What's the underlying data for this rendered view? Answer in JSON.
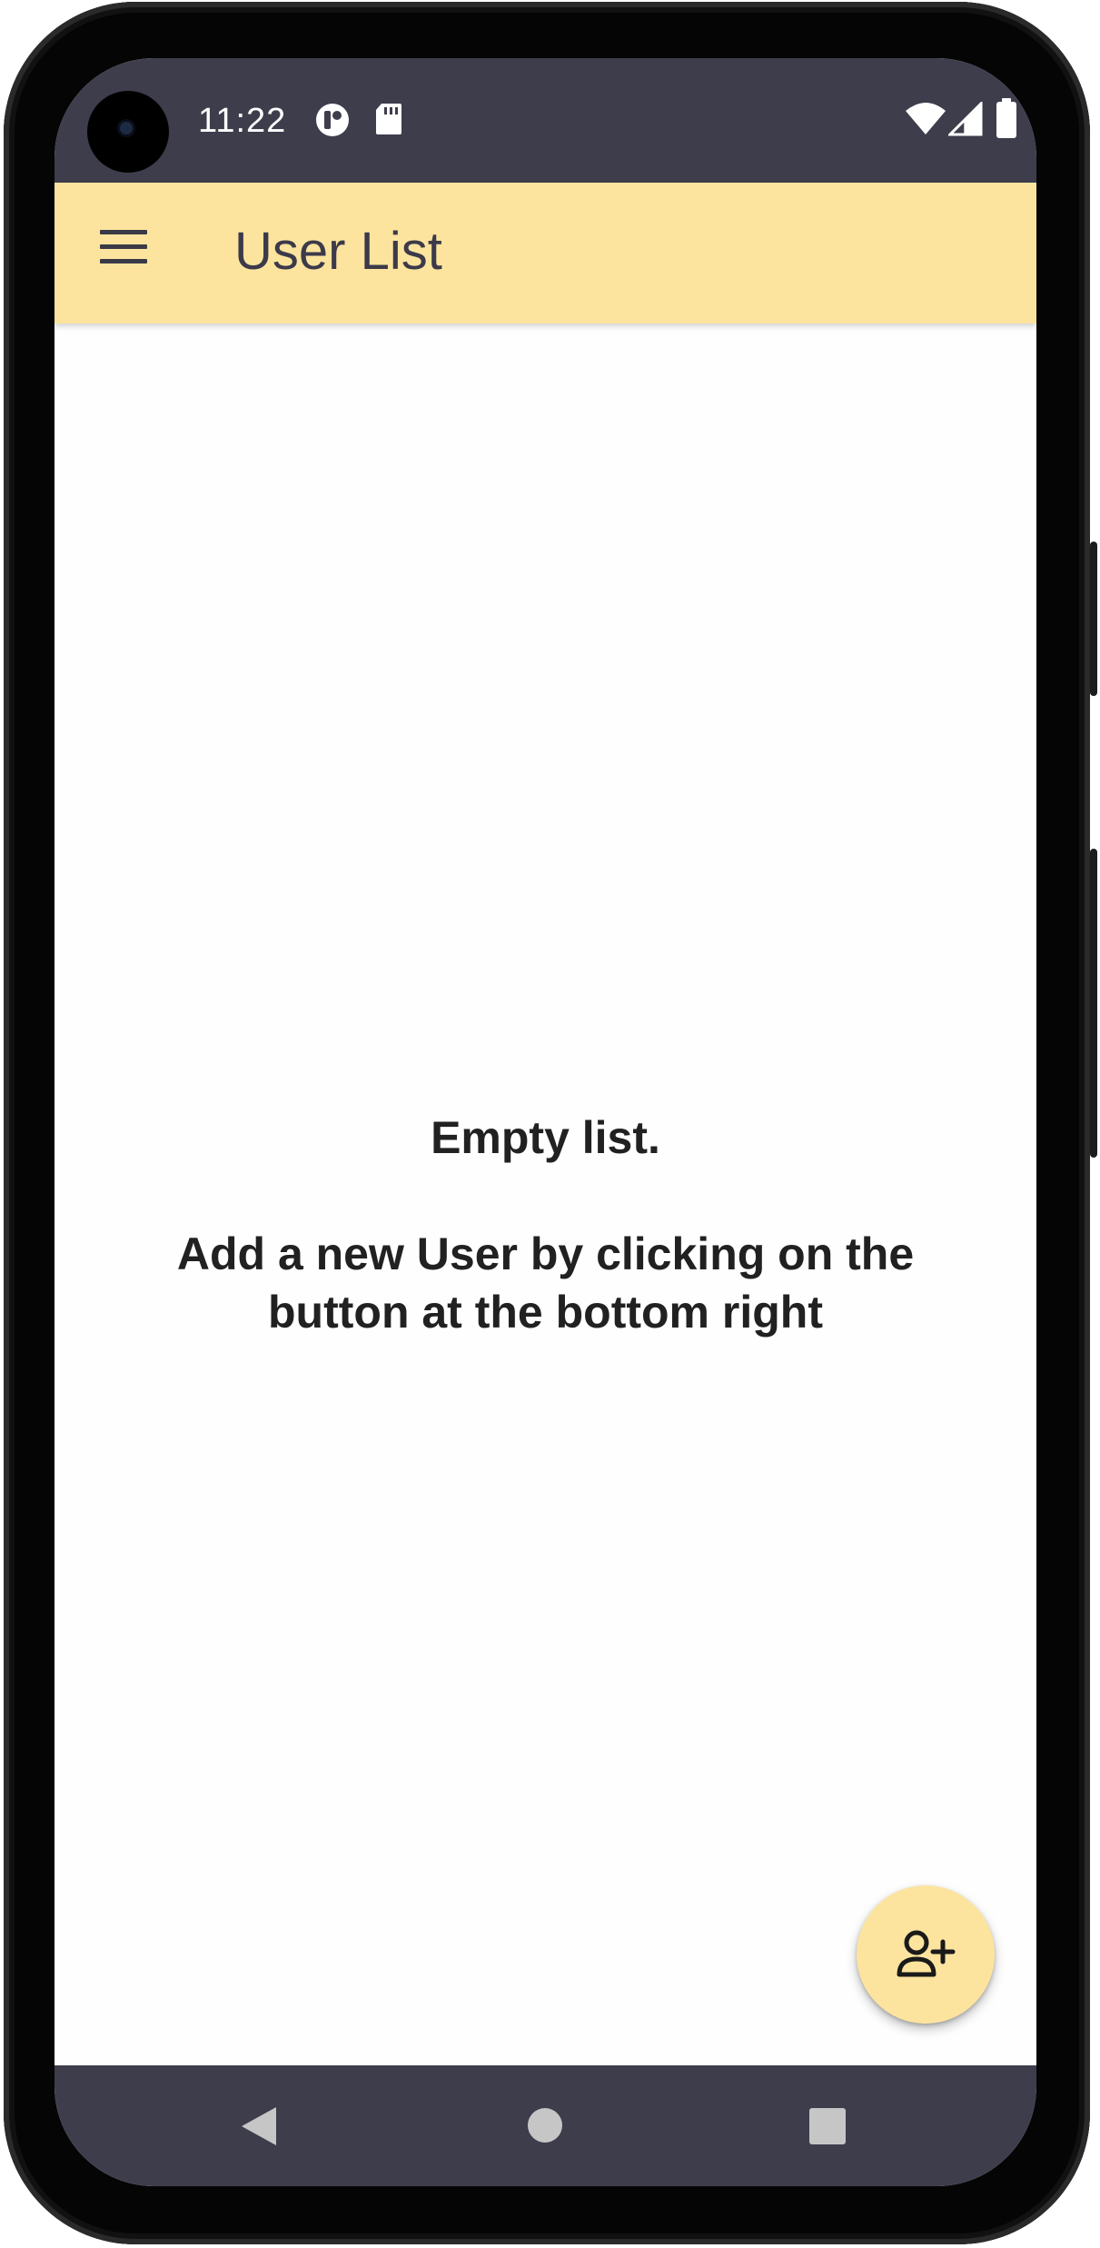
{
  "status_bar": {
    "time": "11:22",
    "icons": [
      "camera-cutout",
      "app-notification-icon",
      "sd-card-icon",
      "wifi-icon",
      "signal-icon",
      "battery-icon"
    ]
  },
  "toolbar": {
    "title": "User List",
    "menu_icon": "hamburger-menu-icon",
    "background_color": "#fde49e"
  },
  "main": {
    "empty_title": "Empty list.",
    "empty_hint": "Add a new User by clicking on the button at the bottom right"
  },
  "fab": {
    "icon": "add-user-icon",
    "background_color": "#fde49e"
  },
  "nav_bar": {
    "buttons": [
      "back-icon",
      "home-icon",
      "recents-icon"
    ]
  }
}
